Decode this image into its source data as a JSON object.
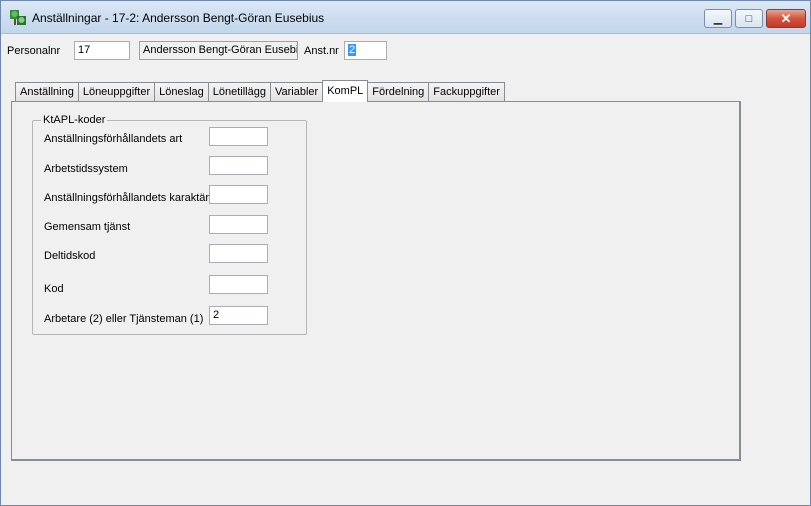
{
  "window": {
    "title": "Anställningar - 17-2: Andersson Bengt-Göran Eusebius",
    "minimize_label": "▁",
    "maximize_label": "□",
    "close_label": "✕",
    "icon": "app-tree-icon"
  },
  "header": {
    "personalnr_label": "Personalnr",
    "personalnr_value": "17",
    "name_value": "Andersson Bengt-Göran Eusebius",
    "anstnr_label": "Anst.nr",
    "anstnr_value": "2"
  },
  "tabs": [
    {
      "label": "Anställning"
    },
    {
      "label": "Löneuppgifter"
    },
    {
      "label": "Löneslag"
    },
    {
      "label": "Lönetillägg"
    },
    {
      "label": "Variabler"
    },
    {
      "label": "KomPL"
    },
    {
      "label": "Fördelning"
    },
    {
      "label": "Fackuppgifter"
    }
  ],
  "active_tab": "KomPL",
  "kompl": {
    "group_title": "KtAPL-koder",
    "rows": [
      {
        "label": "Anställningsförhållandets art",
        "value": ""
      },
      {
        "label": "Arbetstidssystem",
        "value": ""
      },
      {
        "label": "Anställningsförhållandets karaktär",
        "value": ""
      },
      {
        "label": "Gemensam tjänst",
        "value": ""
      },
      {
        "label": "Deltidskod",
        "value": ""
      },
      {
        "label": "Kod",
        "value": ""
      },
      {
        "label": "Arbetare (2) eller Tjänsteman (1)",
        "value": "2"
      }
    ]
  }
}
